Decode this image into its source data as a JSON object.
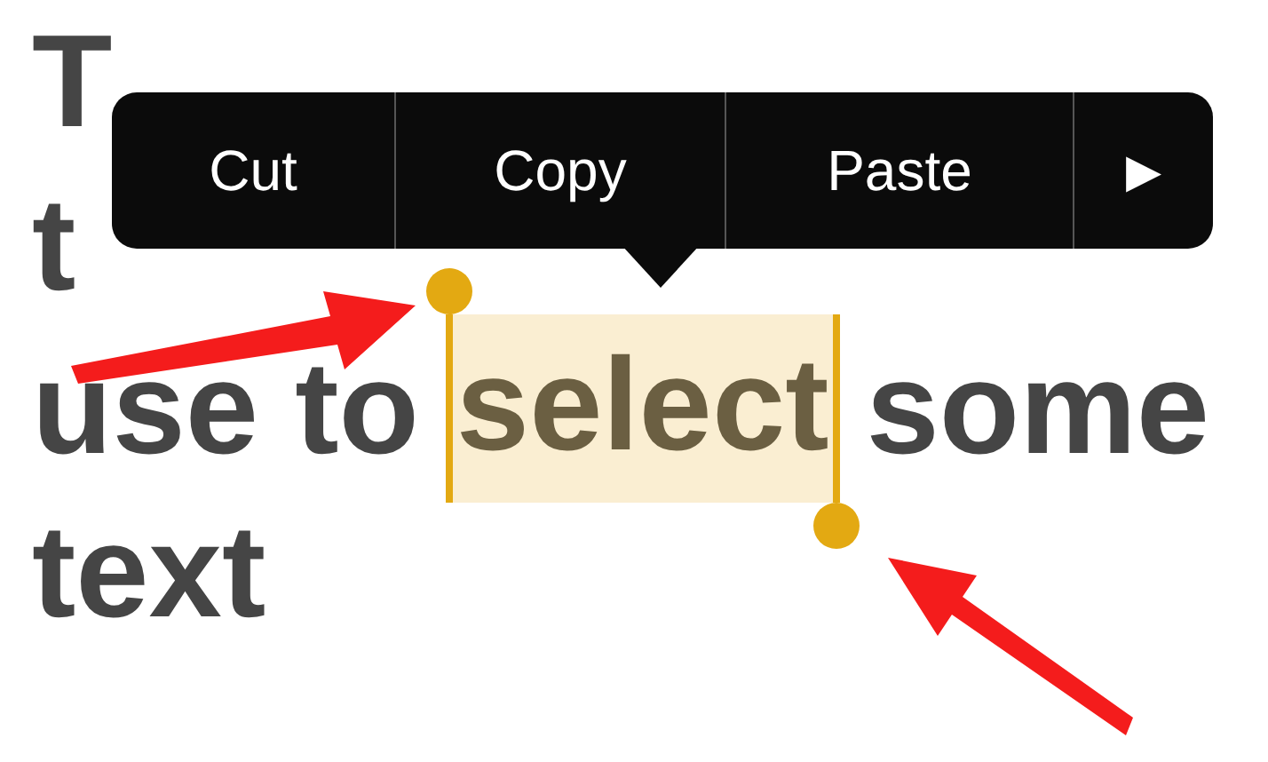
{
  "note": {
    "lines": [
      "T",
      "t"
    ],
    "selection_line": {
      "before": "use to",
      "selected": "select",
      "after": "some"
    },
    "last_line": "text"
  },
  "menu": {
    "items": [
      {
        "label": "Cut",
        "kind": "text"
      },
      {
        "label": "Copy",
        "kind": "text"
      },
      {
        "label": "Paste",
        "kind": "text"
      },
      {
        "label": "▶",
        "kind": "more"
      }
    ]
  }
}
